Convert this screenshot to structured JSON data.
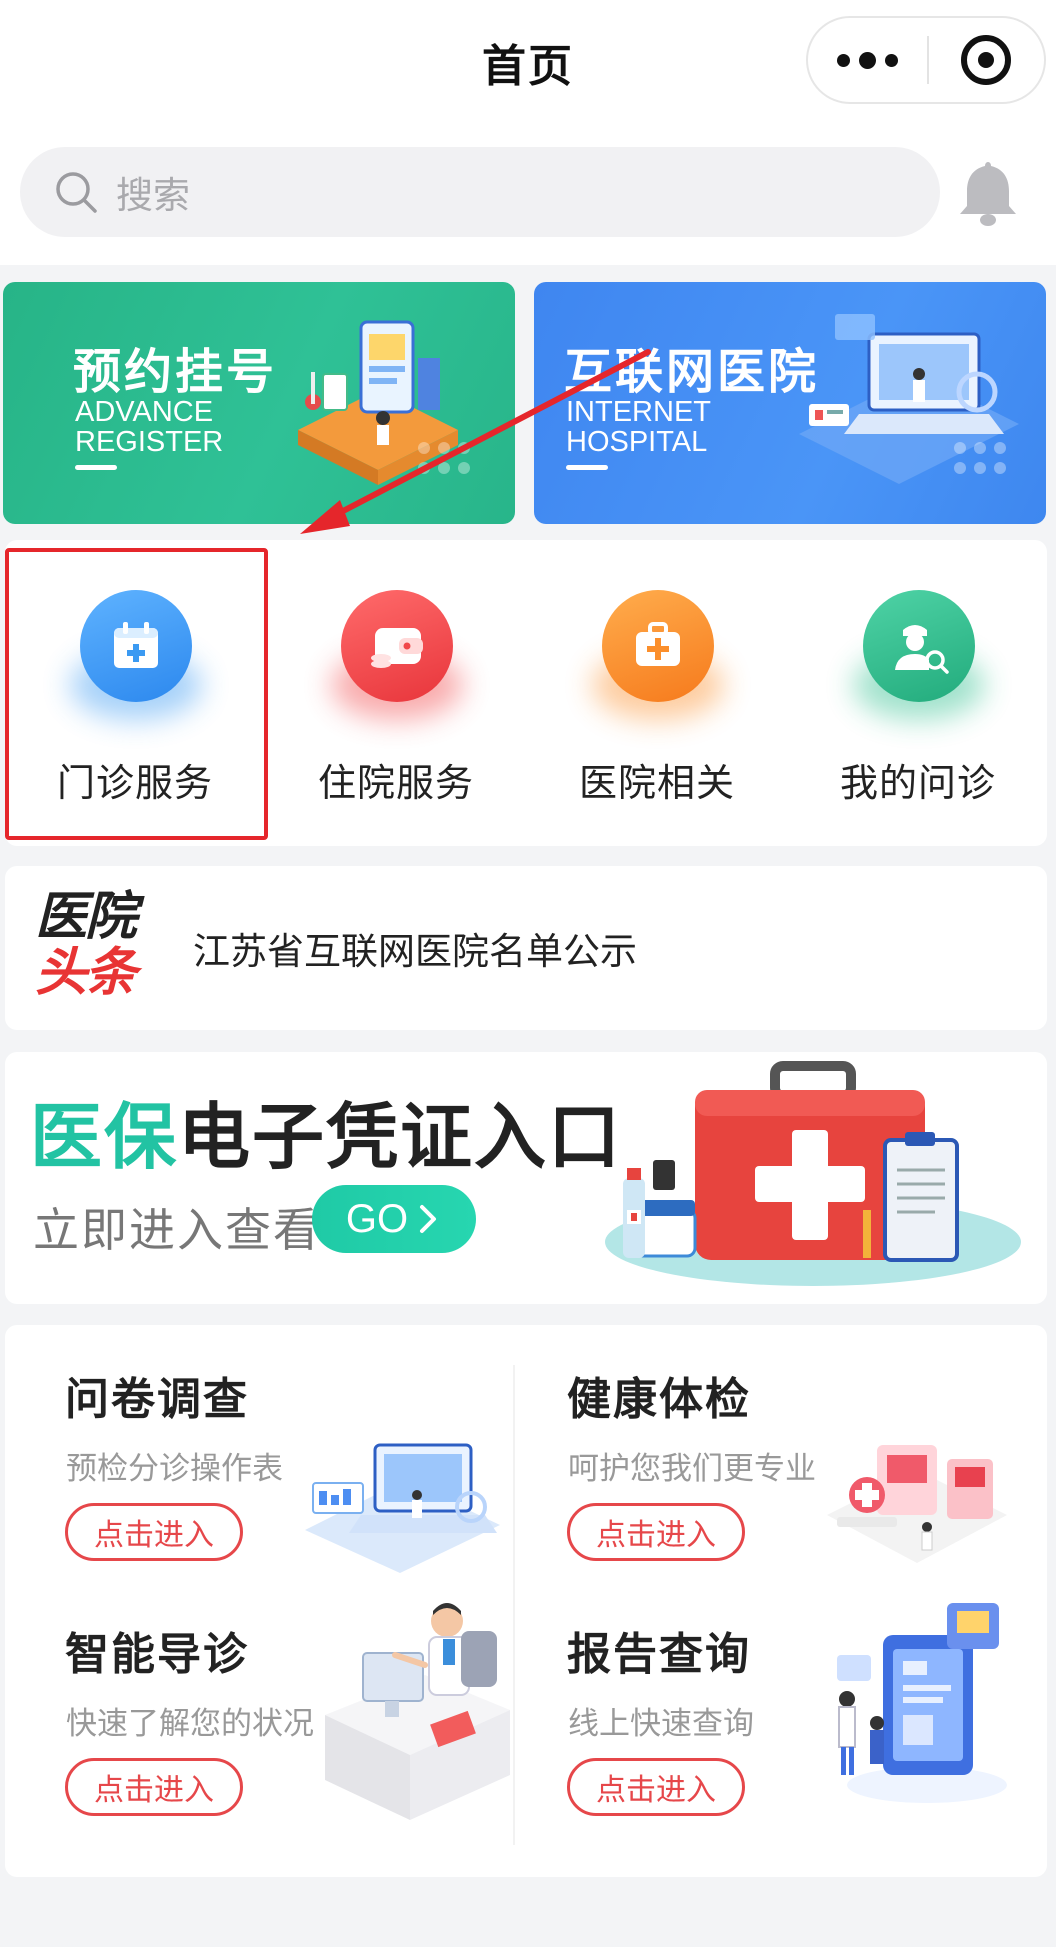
{
  "header": {
    "title": "首页"
  },
  "search": {
    "placeholder": "搜索"
  },
  "banners": [
    {
      "cn": "预约挂号",
      "en1": "ADVANCE",
      "en2": "REGISTER"
    },
    {
      "cn": "互联网医院",
      "en1": "INTERNET",
      "en2": "HOSPITAL"
    }
  ],
  "nav": [
    {
      "label": "门诊服务",
      "icon": "calendar-plus-icon",
      "color": "#3b9af2"
    },
    {
      "label": "住院服务",
      "icon": "wallet-icon",
      "color": "#f1474a"
    },
    {
      "label": "医院相关",
      "icon": "medical-kit-icon",
      "color": "#fb8f2c"
    },
    {
      "label": "我的问诊",
      "icon": "doctor-search-icon",
      "color": "#2fbf8e"
    }
  ],
  "news": {
    "logo_top": "医院",
    "logo_bottom": "头条",
    "text": "江苏省互联网医院名单公示"
  },
  "insurance": {
    "accent": "医保",
    "rest": "电子凭证入口",
    "sub": "立即进入查看",
    "go": "GO"
  },
  "services": [
    {
      "title": "问卷调查",
      "desc": "预检分诊操作表",
      "button": "点击进入"
    },
    {
      "title": "健康体检",
      "desc": "呵护您我们更专业",
      "button": "点击进入"
    },
    {
      "title": "智能导诊",
      "desc": "快速了解您的状况",
      "button": "点击进入"
    },
    {
      "title": "报告查询",
      "desc": "线上快速查询",
      "button": "点击进入"
    }
  ],
  "colors": {
    "accent_green": "#22c3a3",
    "highlight_red": "#e5262b",
    "button_red": "#e6474a"
  }
}
